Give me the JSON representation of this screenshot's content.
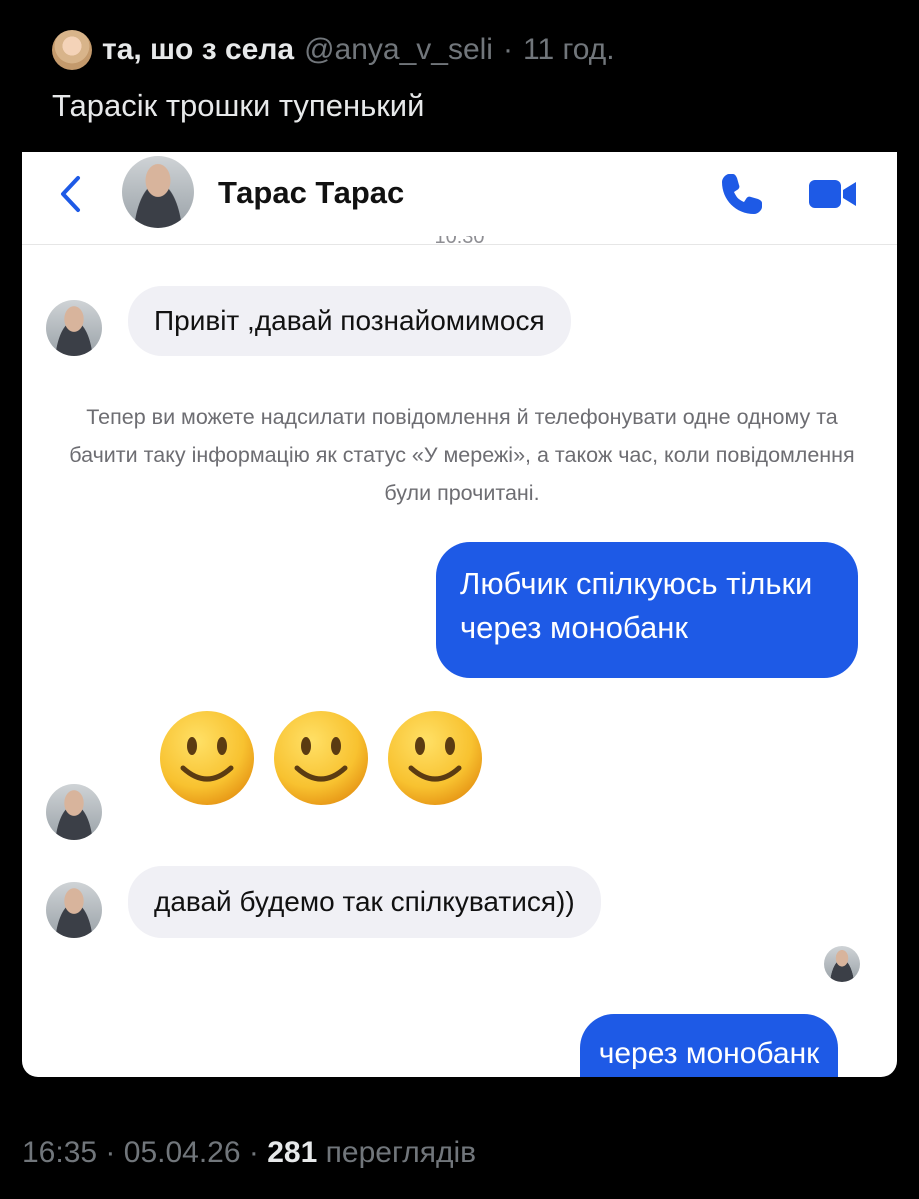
{
  "post": {
    "author_name": "та, шо з села",
    "author_handle": "@anya_v_seli",
    "separator": "·",
    "age": "11 год.",
    "text": "Тарасік трошки тупенький"
  },
  "chat": {
    "contact_name": "Тарас Тарас",
    "time_partial": "10:30",
    "messages": {
      "greeting": "Привіт ,давай познайомимося",
      "system": "Тепер ви можете надсилати повідомлення й телефонувати одне одному та бачити таку інформацію як статус «У мережі», а також час, коли повідомлення були прочитані.",
      "outgoing_1_line1": "Любчик спілкуюсь тільки",
      "outgoing_1_line2": "через монобанк",
      "emojis": [
        "🙂",
        "🙂",
        "🙂"
      ],
      "incoming_2": "давай будемо так спілкуватися))",
      "outgoing_2": "через монобанк"
    },
    "colors": {
      "accent": "#1e5ae6",
      "incoming_bubble": "#f0f0f5"
    },
    "icons": [
      "chevron-left-icon",
      "phone-icon",
      "video-camera-icon"
    ]
  },
  "footer": {
    "time": "16:35",
    "separator": "·",
    "date": "05.04.26",
    "views_count": "281",
    "views_label": "переглядів"
  }
}
